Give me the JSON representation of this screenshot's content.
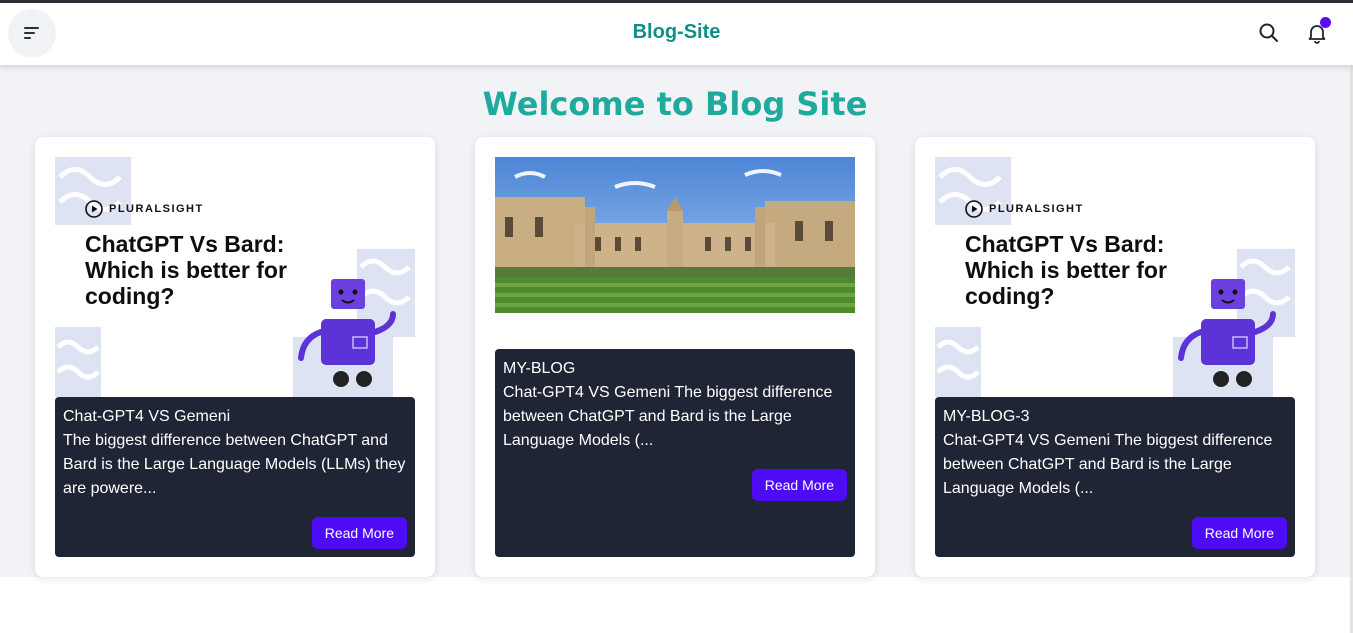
{
  "header": {
    "brand": "Blog-Site",
    "menu_icon": "menu-icon",
    "search_icon": "search-icon",
    "bell_icon": "bell-icon",
    "notification_dot_color": "#5b0af5"
  },
  "main": {
    "title": "Welcome to Blog Site"
  },
  "thumbnail_text": {
    "logo": "PLURALSIGHT",
    "headline": "ChatGPT Vs Bard: Which is better for coding?"
  },
  "cards": [
    {
      "title": "Chat-GPT4 VS Gemeni",
      "excerpt": "The biggest difference between ChatGPT and Bard is the Large Language Models (LLMs) they are powere...",
      "button": "Read More"
    },
    {
      "title": "MY-BLOG",
      "excerpt": "Chat-GPT4 VS Gemeni The biggest difference between ChatGPT and Bard is the Large Language Models (...",
      "button": "Read More"
    },
    {
      "title": "MY-BLOG-3",
      "excerpt": "Chat-GPT4 VS Gemeni The biggest difference between ChatGPT and Bard is the Large Language Models (...",
      "button": "Read More"
    }
  ],
  "colors": {
    "brand": "#0f8f86",
    "title": "#1eab9d",
    "card_info_bg": "#1f2535",
    "button": "#4d0cf5"
  }
}
